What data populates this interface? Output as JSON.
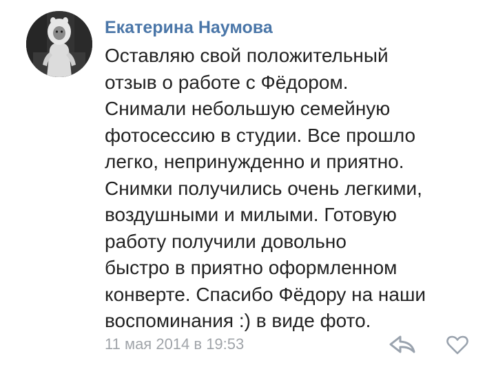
{
  "comment": {
    "author": "Екатерина Наумова",
    "text_lines": [
      "Оставляю свой положительный",
      "отзыв о работе с Фёдором.",
      "Снимали небольшую семейную",
      "фотосессию в студии. Все прошло",
      "легко, непринужденно и приятно.",
      "Снимки получились очень легкими,",
      "воздушными и милыми. Готовую",
      "работу получили довольно",
      "быстро в приятно оформленном",
      "конверте. Спасибо Фёдору на наши",
      "воспоминания :) в виде фото."
    ],
    "timestamp": "11 мая 2014 в 19:53"
  },
  "icons": {
    "reply": "reply-arrow-icon",
    "like": "heart-outline-icon"
  },
  "colors": {
    "author": "#4a76a8",
    "text": "#222222",
    "timestamp": "#a0a4a9",
    "icon": "#99a2ad"
  }
}
